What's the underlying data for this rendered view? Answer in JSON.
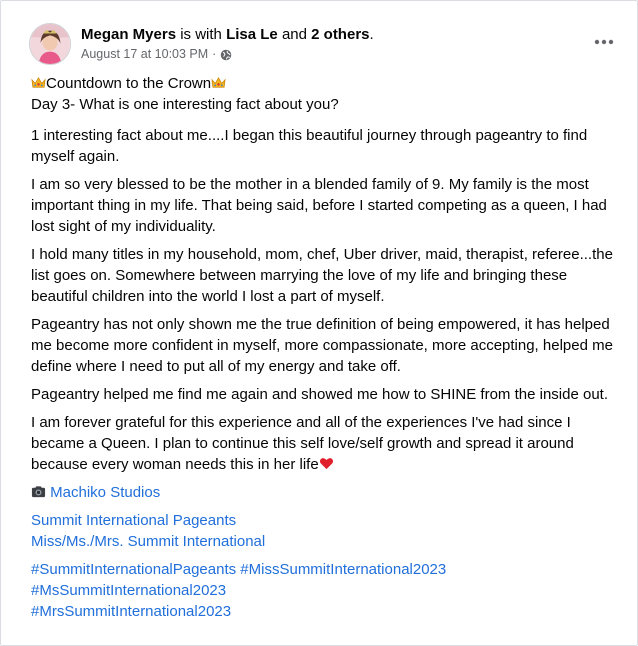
{
  "post": {
    "author": "Megan Myers",
    "with_text": "is with",
    "tagged_person": "Lisa Le",
    "and_text": "and",
    "others": "2 others",
    "period": ".",
    "timestamp": "August 17 at 10:03 PM",
    "separator": "·",
    "privacy_icon": "globe-icon",
    "menu_icon": "more-dots-icon"
  },
  "content": {
    "title": "Countdown to the Crown",
    "title_icon": "crown-icon",
    "line2": "Day 3- What is one interesting fact about you?",
    "p1": "1 interesting fact about me....I began this beautiful journey through pageantry to find myself again.",
    "p2": "I am so very blessed to be the mother in a blended family of 9.  My family is the most important thing in my life.  That being said, before I started competing as a queen, I had lost sight of my individuality.",
    "p3": "I hold many titles in my household, mom, chef, Uber driver, maid, therapist, referee...the list goes on.  Somewhere between marrying the love of my life and bringing these beautiful children into the world I lost a part of myself.",
    "p4": "Pageantry has not only shown me the true definition of being empowered, it has helped me become more confident in myself, more compassionate, more accepting, helped me define where I need to put all of my energy and take off.",
    "p5": "Pageantry helped me find me again and showed me how to SHINE from the inside out.",
    "p6": "I am forever grateful for this experience and all of the experiences I've had since I became a Queen.  I plan to continue this self love/self growth and spread it around because every woman needs this in her life",
    "p6_icon": "red-heart-icon",
    "photo_icon": "camera-icon",
    "photo_credit": "Machiko Studios",
    "link1": "Summit International Pageants",
    "link2": "Miss/Ms./Mrs. Summit International",
    "hashtag1": "#SummitInternationalPageants",
    "hashtag2": "#MissSummitInternational2023",
    "hashtag3": "#MsSummitInternational2023",
    "hashtag4": "#MrsSummitInternational2023"
  },
  "colors": {
    "link": "#216fdb",
    "meta": "#65676b",
    "text": "#050505"
  }
}
